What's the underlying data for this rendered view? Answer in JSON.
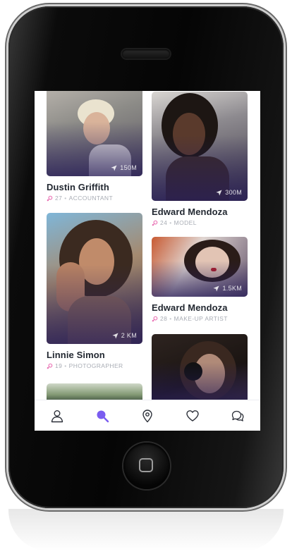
{
  "colors": {
    "accent": "#7a5cf0",
    "icon": "#2b2f38",
    "gender_female": "#e86ab0",
    "name_text": "#222831",
    "meta_text": "#a9adb5"
  },
  "profiles": [
    {
      "name": "Dustin Griffith",
      "age": "27",
      "occupation": "ACCOUNTANT",
      "distance": "150M"
    },
    {
      "name": "Edward Mendoza",
      "age": "24",
      "occupation": "MODEL",
      "distance": "300M"
    },
    {
      "name": "Linnie Simon",
      "age": "19",
      "occupation": "PHOTOGRAPHER",
      "distance": "2 KM"
    },
    {
      "name": "Edward Mendoza",
      "age": "28",
      "occupation": "MAKE-UP ARTIST",
      "distance": "1.5KM"
    }
  ],
  "tabbar": {
    "active": "search",
    "items": [
      {
        "id": "profile",
        "icon": "person-icon"
      },
      {
        "id": "search",
        "icon": "search-icon"
      },
      {
        "id": "nearby",
        "icon": "location-pin-icon"
      },
      {
        "id": "likes",
        "icon": "heart-icon"
      },
      {
        "id": "messages",
        "icon": "chat-bubbles-icon"
      }
    ]
  }
}
